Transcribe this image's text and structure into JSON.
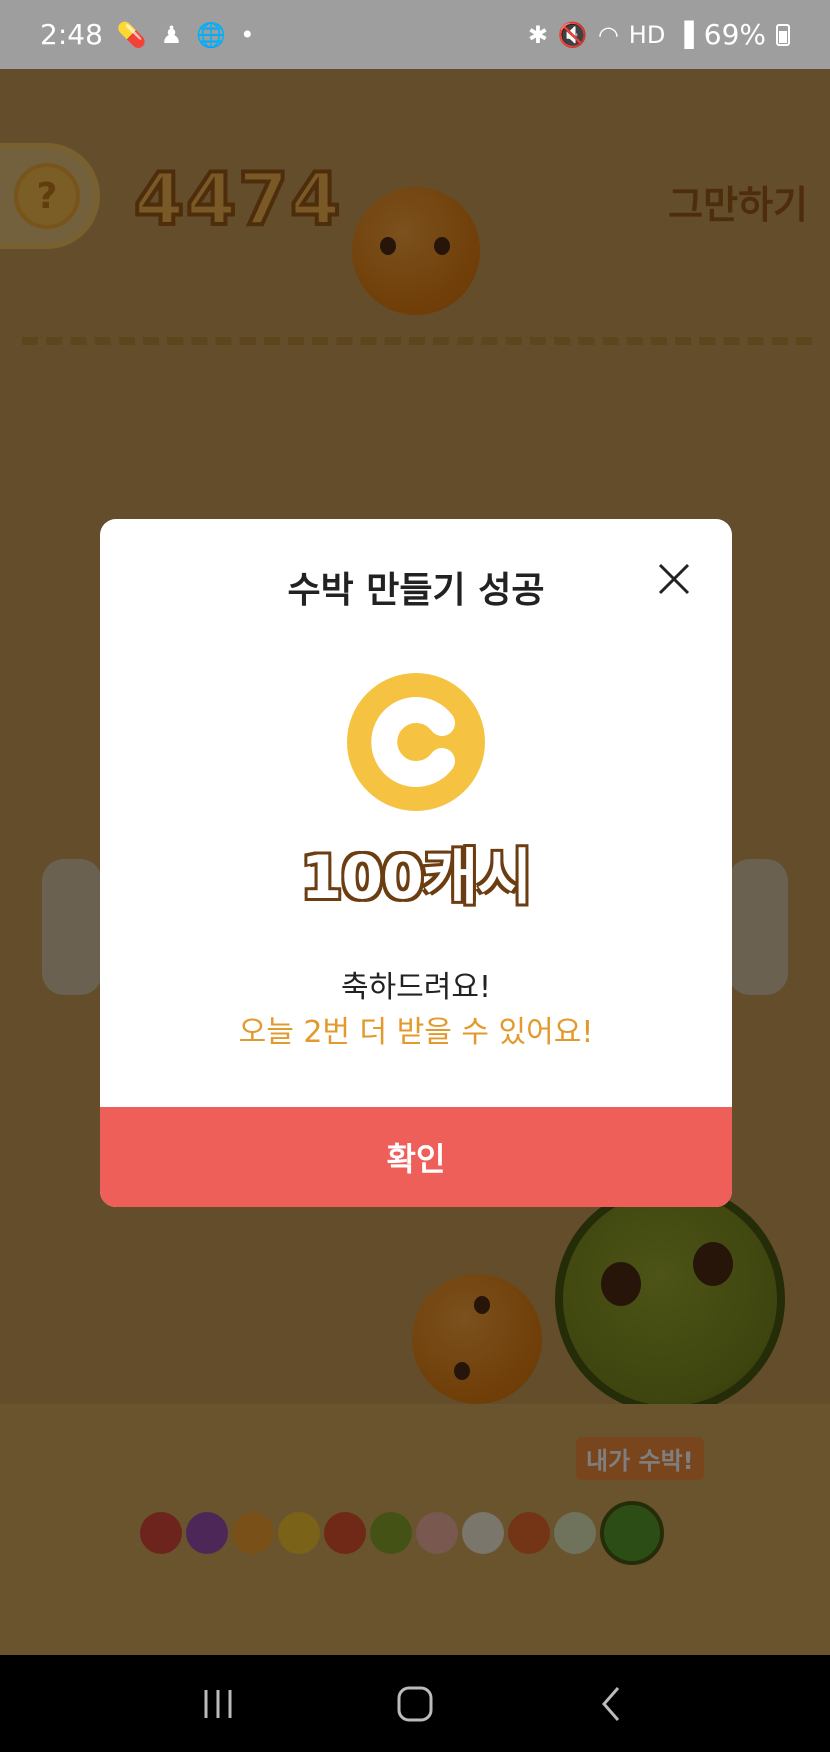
{
  "status_bar": {
    "time": "2:48",
    "battery": "69%",
    "left_icons": [
      "pill-icon",
      "person-icon",
      "globe-icon",
      "dot-icon"
    ],
    "right_icons": [
      "bluetooth-icon",
      "mute-icon",
      "wifi-icon",
      "hd-icon",
      "signal-icon",
      "battery-icon"
    ]
  },
  "game": {
    "help_label": "?",
    "score": "4474",
    "stop_label": "그만하기",
    "melon_tag": "내가 수박!"
  },
  "modal": {
    "title": "수박 만들기 성공",
    "reward": "100캐시",
    "congrats": "축하드려요!",
    "remaining": "오늘 2번 더 받을 수 있어요!",
    "confirm_label": "확인",
    "accent_color": "#ee5f5a",
    "coin_color": "#f5c242"
  },
  "nav": {
    "icons": [
      "recent-apps-icon",
      "home-icon",
      "back-icon"
    ]
  }
}
